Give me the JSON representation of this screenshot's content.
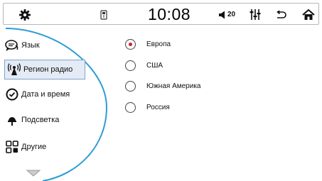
{
  "status_bar": {
    "time": "10:08",
    "volume": "20"
  },
  "sidebar": {
    "items": [
      {
        "label": "Язык",
        "icon": "speech-bubble-icon"
      },
      {
        "label": "Регион радио",
        "icon": "radio-antenna-icon",
        "selected": true
      },
      {
        "label": "Дата и время",
        "icon": "clock-icon"
      },
      {
        "label": "Подсветка",
        "icon": "lamp-icon"
      },
      {
        "label": "Другие",
        "icon": "grid-icon"
      }
    ]
  },
  "region_options": [
    {
      "label": "Европа",
      "selected": true
    },
    {
      "label": "США",
      "selected": false
    },
    {
      "label": "Южная Америка",
      "selected": false
    },
    {
      "label": "Россия",
      "selected": false
    }
  ],
  "colors": {
    "accent_arc": "#2e9bd6",
    "selected_radio": "#c82030",
    "selected_item_bg": "#e4ebf4"
  }
}
